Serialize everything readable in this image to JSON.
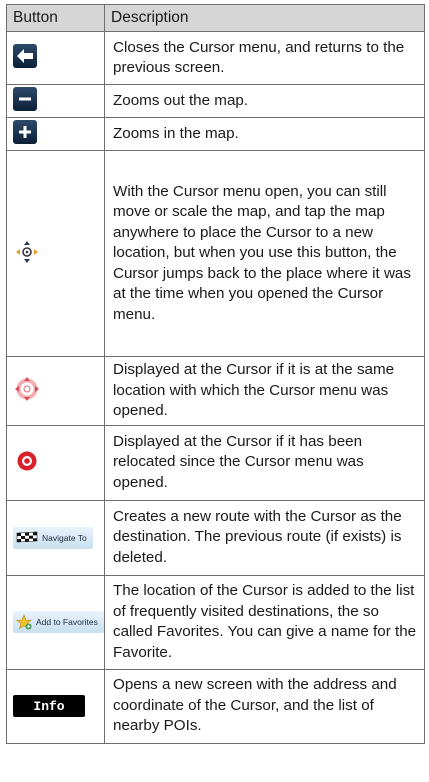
{
  "header": {
    "col_button": "Button",
    "col_description": "Description"
  },
  "rows": [
    {
      "icon": "back-arrow-icon",
      "description": "Closes the Cursor menu, and returns to the previous screen."
    },
    {
      "icon": "minus-icon",
      "description": "Zooms out the map."
    },
    {
      "icon": "plus-icon",
      "description": "Zooms in the map."
    },
    {
      "icon": "recenter-icon",
      "description": "With the Cursor menu open, you can still move or scale the map, and tap the map anywhere to place the Cursor to a new location, but when you use this button, the Cursor jumps back to the place where it was at the time when you opened the Cursor menu."
    },
    {
      "icon": "cursor-original-icon",
      "description": "Displayed at the Cursor if it is at the same location with which the Cursor menu was opened."
    },
    {
      "icon": "cursor-relocated-icon",
      "description": "Displayed at the Cursor if it has been relocated since the Cursor menu was opened."
    },
    {
      "icon": "checkered-flag-icon",
      "button_label": "Navigate To",
      "description": "Creates a new route with the Cursor as the destination. The previous route (if exists) is deleted."
    },
    {
      "icon": "star-plus-icon",
      "button_label": "Add to Favorites",
      "description": "The location of the Cursor is added to the list of frequently visited destinations, the so called Favorites. You can give a name for the Favorite."
    },
    {
      "icon": "info-button",
      "button_label": "Info",
      "description": "Opens a new screen with the address and coordinate of the Cursor, and the list of nearby POIs."
    }
  ],
  "colors": {
    "header_bg": "#d6d6d6",
    "border": "#6e6e6e",
    "cursor_red": "#d9212a",
    "button_dark": "#0c2036"
  }
}
